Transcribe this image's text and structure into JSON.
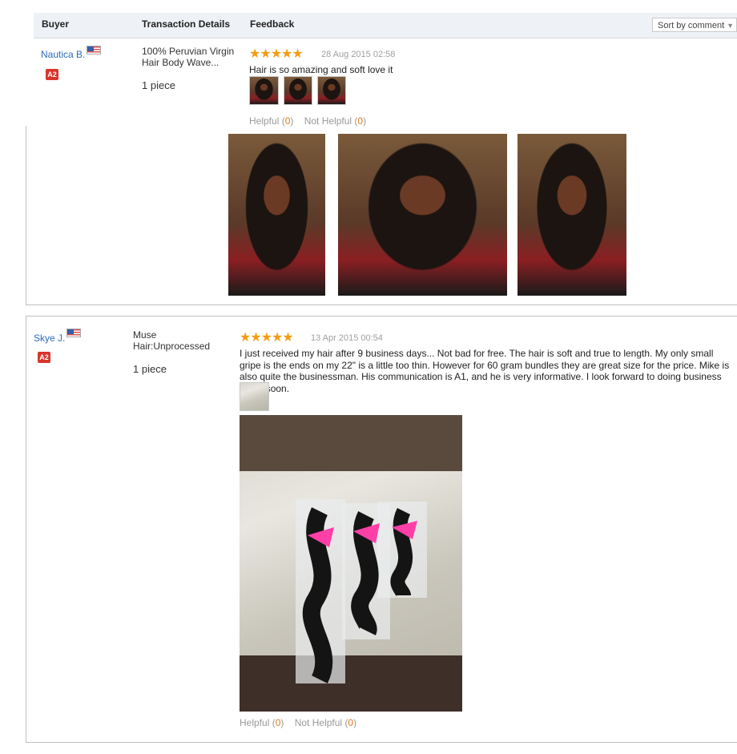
{
  "header": {
    "col_buyer": "Buyer",
    "col_transaction": "Transaction Details",
    "col_feedback": "Feedback",
    "sort_label": "Sort by comment"
  },
  "reviews": [
    {
      "buyer": "Nautica B.",
      "badge": "A2",
      "product": [
        "100% Peruvian Virgin",
        "Hair Body Wave..."
      ],
      "quantity": "1 piece",
      "stars": "★★★★★",
      "date": "28 Aug 2015 02:58",
      "text": "Hair is so amazing and soft love it",
      "helpful_label": "Helpful (",
      "helpful_count": "0",
      "not_helpful_label": "Not Helpful (",
      "not_helpful_count": "0",
      "close_paren": ")"
    },
    {
      "buyer": "Skye J.",
      "badge": "A2",
      "product": [
        "Muse",
        "Hair:Unprocessed"
      ],
      "quantity": "1 piece",
      "stars": "★★★★★",
      "date": "13 Apr 2015 00:54",
      "text": "I just received my hair after 9 business days... Not bad for free. The hair is soft and true to length. My only small gripe is the ends on my 22\" is a little too thin. However for 60 gram bundles they are great size for the price. Mike is also quite the businessman. His communication is A1, and he is very informative. I look forward to doing business again soon.",
      "helpful_label": "Helpful (",
      "helpful_count": "0",
      "not_helpful_label": "Not Helpful (",
      "not_helpful_count": "0",
      "close_paren": ")"
    }
  ],
  "colors": {
    "link": "#2b6cb8",
    "star": "#f39c12",
    "badge": "#d9342b",
    "count": "#e07b1a",
    "header_bg": "#eef1f6"
  }
}
